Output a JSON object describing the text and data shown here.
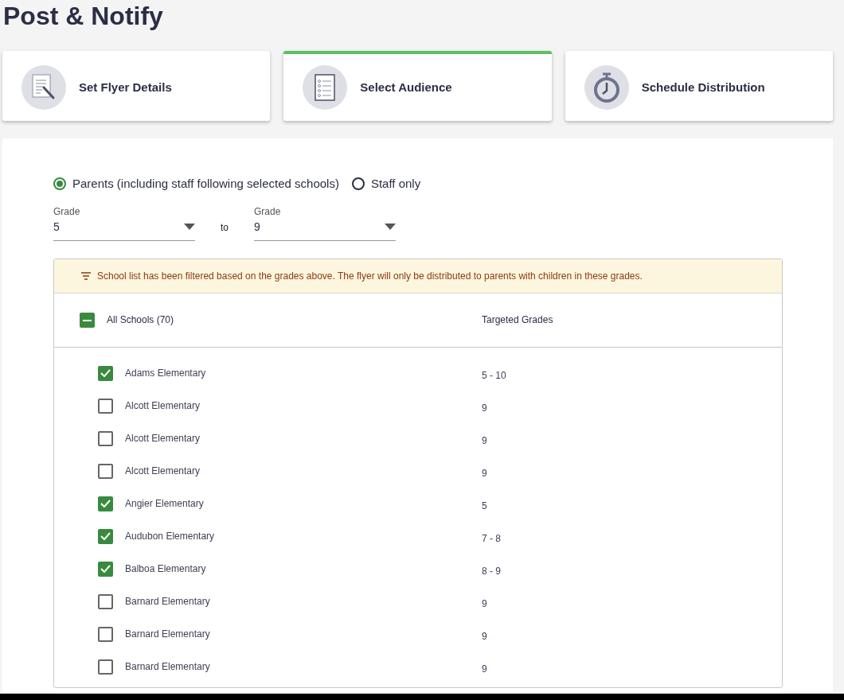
{
  "page_title": "Post & Notify",
  "steps": [
    {
      "label": "Set Flyer Details",
      "selected": false
    },
    {
      "label": "Select Audience",
      "selected": true
    },
    {
      "label": "Schedule Distribution",
      "selected": false
    }
  ],
  "audience": [
    {
      "label": "Parents (including staff following selected schools)",
      "selected": true
    },
    {
      "label": "Staff only",
      "selected": false
    }
  ],
  "grade_from": {
    "label": "Grade",
    "value": "5"
  },
  "range_separator": "to",
  "grade_to": {
    "label": "Grade",
    "value": "9"
  },
  "filter_notice": "School list has been filtered based on the grades above. The flyer will only be distributed to parents with children in these grades.",
  "table": {
    "select_all": {
      "label": "All Schools (70)",
      "indeterminate": true
    },
    "columns": [
      "Targeted Grades"
    ],
    "rows": [
      {
        "name": "Adams Elementary",
        "grades": "5 - 10",
        "checked": true
      },
      {
        "name": "Alcott Elementary",
        "grades": "9",
        "checked": false
      },
      {
        "name": "Alcott Elementary",
        "grades": "9",
        "checked": false
      },
      {
        "name": "Alcott Elementary",
        "grades": "9",
        "checked": false
      },
      {
        "name": "Angier Elementary",
        "grades": "5",
        "checked": true
      },
      {
        "name": "Audubon Elementary",
        "grades": "7 - 8",
        "checked": true
      },
      {
        "name": "Balboa Elementary",
        "grades": "8 - 9",
        "checked": true
      },
      {
        "name": "Barnard Elementary",
        "grades": "9",
        "checked": false
      },
      {
        "name": "Barnard Elementary",
        "grades": "9",
        "checked": false
      },
      {
        "name": "Barnard Elementary",
        "grades": "9",
        "checked": false
      }
    ]
  }
}
